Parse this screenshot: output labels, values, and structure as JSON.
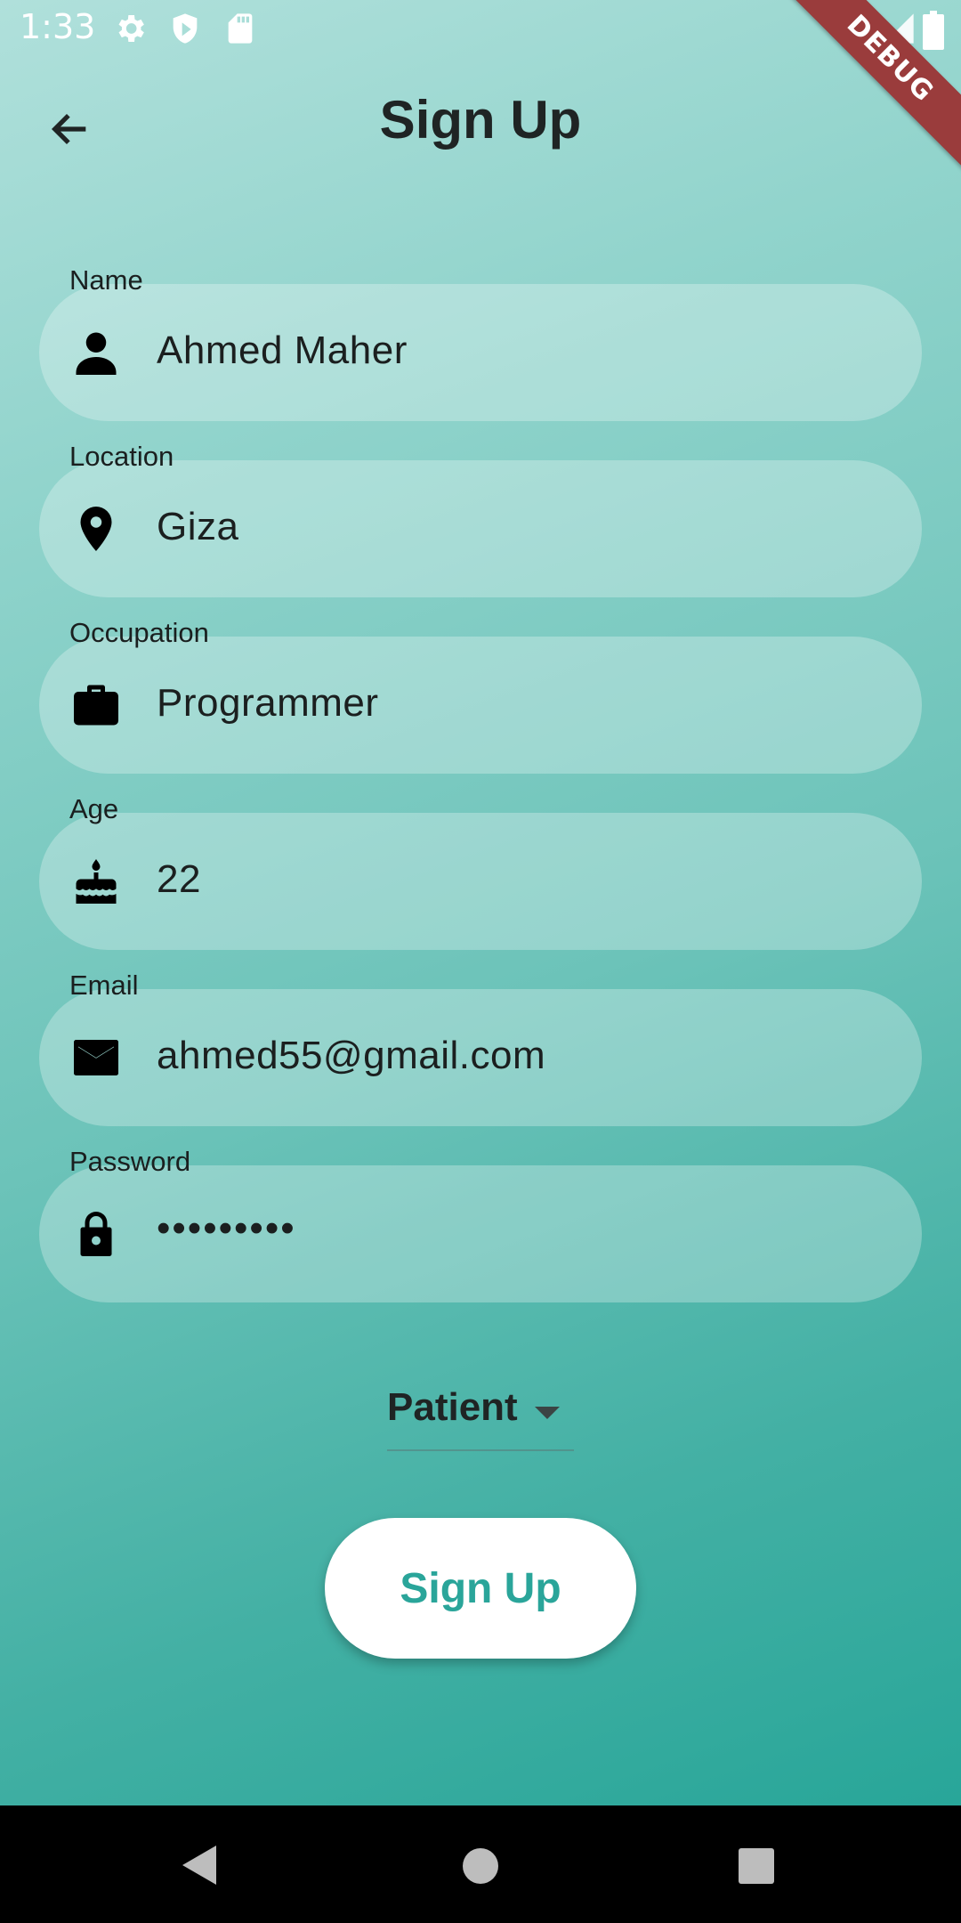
{
  "status_bar": {
    "time": "1:33"
  },
  "debug_banner": "DEBUG",
  "app_bar": {
    "title": "Sign Up"
  },
  "fields": [
    {
      "label": "Name",
      "value": "Ahmed Maher",
      "icon": "person-icon"
    },
    {
      "label": "Location",
      "value": "Giza",
      "icon": "location-pin-icon"
    },
    {
      "label": "Occupation",
      "value": "Programmer",
      "icon": "briefcase-icon"
    },
    {
      "label": "Age",
      "value": "22",
      "icon": "cake-icon"
    },
    {
      "label": "Email",
      "value": "ahmed55@gmail.com",
      "icon": "mail-icon"
    },
    {
      "label": "Password",
      "value": "•••••••••",
      "icon": "lock-icon"
    }
  ],
  "role_dropdown": {
    "selected": "Patient"
  },
  "signup_button": {
    "label": "Sign Up"
  },
  "colors": {
    "accent": "#2aa59a",
    "debug": "#9a3c3c"
  }
}
